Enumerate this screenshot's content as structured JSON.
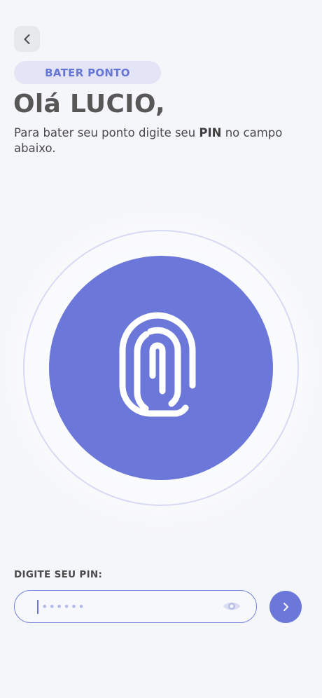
{
  "header": {
    "back_icon": "chevron-left-icon",
    "tag_label": "BATER PONTO",
    "title": "Olá LUCIO,",
    "subtitle_before": "Para bater seu ponto digite seu ",
    "subtitle_bold": "PIN",
    "subtitle_after": " no campo abaixo."
  },
  "fingerprint": {
    "icon": "fingerprint-icon",
    "color": "#6b78da"
  },
  "pin": {
    "label": "DIGITE SEU PIN:",
    "placeholder": "••••••",
    "value": "",
    "toggle_icon": "eye-icon",
    "submit_icon": "chevron-right-icon"
  },
  "colors": {
    "accent": "#6b78da",
    "tag_background": "#e3e5f6",
    "background": "#f5f6f9"
  }
}
